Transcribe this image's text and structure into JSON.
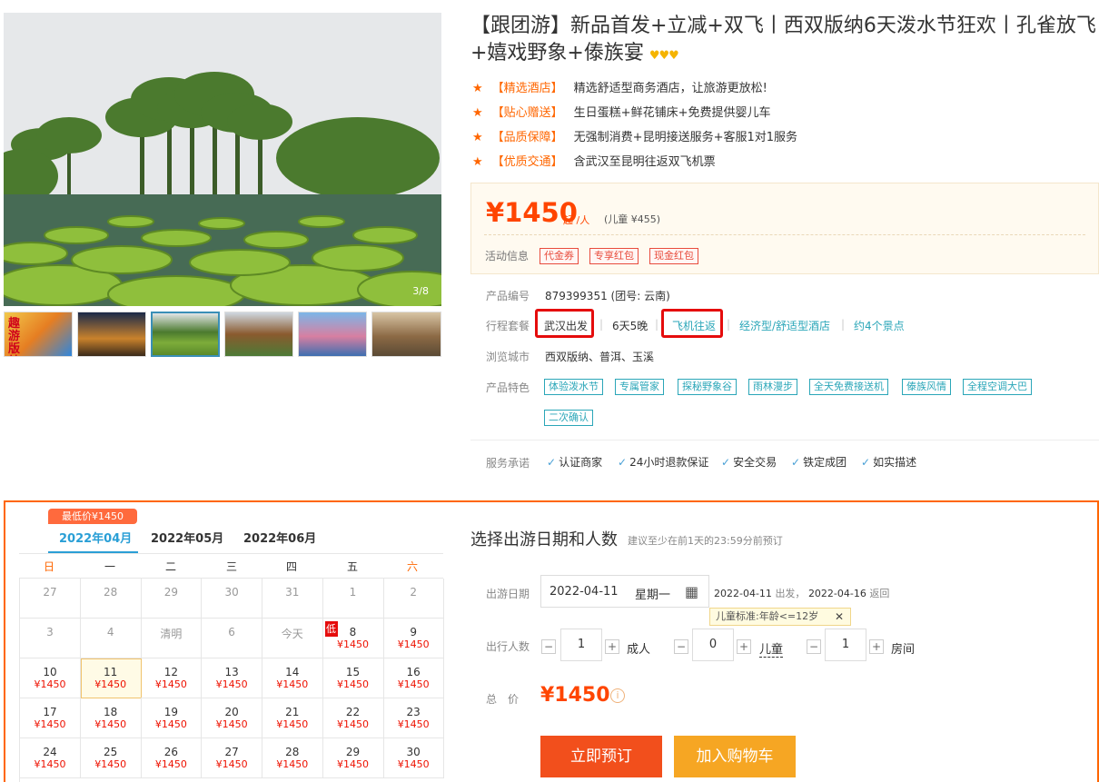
{
  "gallery": {
    "counter": "3/8",
    "thumb_labels": [
      "趣游版纳"
    ]
  },
  "product": {
    "title": "【跟团游】新品首发+立减+双飞丨西双版纳6天泼水节狂欢丨孔雀放飞+嬉戏野象+傣族宴",
    "crowns": "♥♥♥",
    "features": [
      {
        "tag": "【精选酒店】",
        "text": "精选舒适型商务酒店，让旅游更放松!"
      },
      {
        "tag": "【贴心赠送】",
        "text": "生日蛋糕+鲜花铺床+免费提供婴儿车"
      },
      {
        "tag": "【品质保障】",
        "text": "无强制消费+昆明接送服务+客服1对1服务"
      },
      {
        "tag": "【优质交通】",
        "text": "含武汉至昆明往返双飞机票"
      }
    ]
  },
  "price": {
    "amount": "¥1450",
    "unit": "起 /人",
    "child": "(儿童 ¥455)",
    "activity_label": "活动信息",
    "tags": [
      "代金券",
      "专享红包",
      "现金红包"
    ]
  },
  "info": {
    "code_label": "产品编号",
    "code_value": "879399351 (团号: 云南)",
    "package_label": "行程套餐",
    "depart": "武汉出发",
    "days": "6天5晚",
    "transport": "飞机往返",
    "hotel": "经济型/舒适型酒店",
    "spots": "约4个景点",
    "cities_label": "浏览城市",
    "cities_value": "西双版纳、普洱、玉溪",
    "features_label": "产品特色",
    "feature_tags": [
      "体验泼水节",
      "专属管家",
      "探秘野象谷",
      "雨林漫步",
      "全天免费接送机",
      "傣族风情",
      "全程空调大巴",
      "二次确认"
    ],
    "service_label": "服务承诺",
    "services": [
      "认证商家",
      "24小时退款保证",
      "安全交易",
      "铁定成团",
      "如实描述"
    ]
  },
  "calendar": {
    "lowest_badge": "最低价¥1450",
    "months": [
      "2022年04月",
      "2022年05月",
      "2022年06月"
    ],
    "weekdays": [
      "日",
      "一",
      "二",
      "三",
      "四",
      "五",
      "六"
    ],
    "low_label": "低",
    "rows": [
      [
        {
          "d": "27"
        },
        {
          "d": "28"
        },
        {
          "d": "29"
        },
        {
          "d": "30"
        },
        {
          "d": "31"
        },
        {
          "d": "1"
        },
        {
          "d": "2"
        }
      ],
      [
        {
          "d": "3"
        },
        {
          "d": "4"
        },
        {
          "d": "清明"
        },
        {
          "d": "6"
        },
        {
          "d": "今天"
        },
        {
          "d": "8",
          "p": "¥1450"
        },
        {
          "d": "9",
          "p": "¥1450"
        }
      ],
      [
        {
          "d": "10",
          "p": "¥1450"
        },
        {
          "d": "11",
          "p": "¥1450"
        },
        {
          "d": "12",
          "p": "¥1450"
        },
        {
          "d": "13",
          "p": "¥1450"
        },
        {
          "d": "14",
          "p": "¥1450"
        },
        {
          "d": "15",
          "p": "¥1450"
        },
        {
          "d": "16",
          "p": "¥1450"
        }
      ],
      [
        {
          "d": "17",
          "p": "¥1450"
        },
        {
          "d": "18",
          "p": "¥1450"
        },
        {
          "d": "19",
          "p": "¥1450"
        },
        {
          "d": "20",
          "p": "¥1450"
        },
        {
          "d": "21",
          "p": "¥1450"
        },
        {
          "d": "22",
          "p": "¥1450"
        },
        {
          "d": "23",
          "p": "¥1450"
        }
      ],
      [
        {
          "d": "24",
          "p": "¥1450"
        },
        {
          "d": "25",
          "p": "¥1450"
        },
        {
          "d": "26",
          "p": "¥1450"
        },
        {
          "d": "27",
          "p": "¥1450"
        },
        {
          "d": "28",
          "p": "¥1450"
        },
        {
          "d": "29",
          "p": "¥1450"
        },
        {
          "d": "30",
          "p": "¥1450"
        }
      ]
    ]
  },
  "booking": {
    "title": "选择出游日期和人数",
    "note": "建议至少在前1天的23:59分前预订",
    "date_label": "出游日期",
    "date_value": "2022-04-11",
    "date_weekday": "星期一",
    "date_summary_start": "2022-04-11",
    "date_summary_start_suffix": "出发，",
    "date_summary_end": "2022-04-16",
    "date_summary_end_suffix": "返回",
    "tip": "儿童标准:年龄<=12岁",
    "people_label": "出行人数",
    "adults": "1",
    "adults_label": "成人",
    "children": "0",
    "children_label": "儿童",
    "rooms": "1",
    "rooms_label": "房间",
    "total_label": "总　价",
    "total": "¥1450",
    "book_button": "立即预订",
    "cart_button": "加入购物车"
  },
  "colors": {
    "accent": "#ff6600",
    "price": "#ff4500",
    "teal": "#2aa6b8",
    "highlight": "#e50c0c"
  }
}
